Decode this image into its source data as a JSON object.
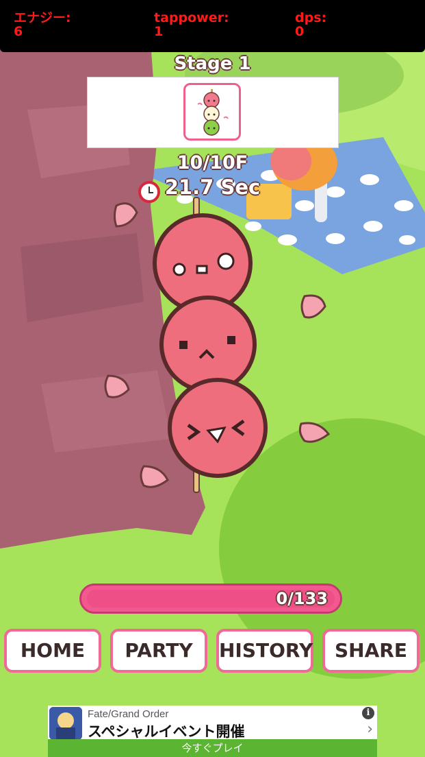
{
  "hud": {
    "energy_label": "エナジー:",
    "energy_value": "6",
    "tappower_label": "tappower:",
    "tappower_value": "1",
    "dps_label": "dps:",
    "dps_value": "0"
  },
  "stage": {
    "title": "Stage 1",
    "floor": "10/10F",
    "time": "21.7 Sec"
  },
  "enemy": {
    "name_icon": "dango-icon"
  },
  "hp_bar": {
    "label": "0/133",
    "fill_fraction": 0
  },
  "menu": {
    "home": "HOME",
    "party": "PARTY",
    "history": "HISTORY",
    "share": "SHARE"
  },
  "ad": {
    "source": "Fate/Grand Order",
    "headline": "スペシャルイベント開催",
    "cta": "今すぐプレイ",
    "info": "i",
    "arrow": "›"
  },
  "colors": {
    "hud_text": "#ff1a1a",
    "accent_pink": "#ef6a97",
    "grass": "#8fd94a",
    "cta_green": "#5cb532"
  }
}
